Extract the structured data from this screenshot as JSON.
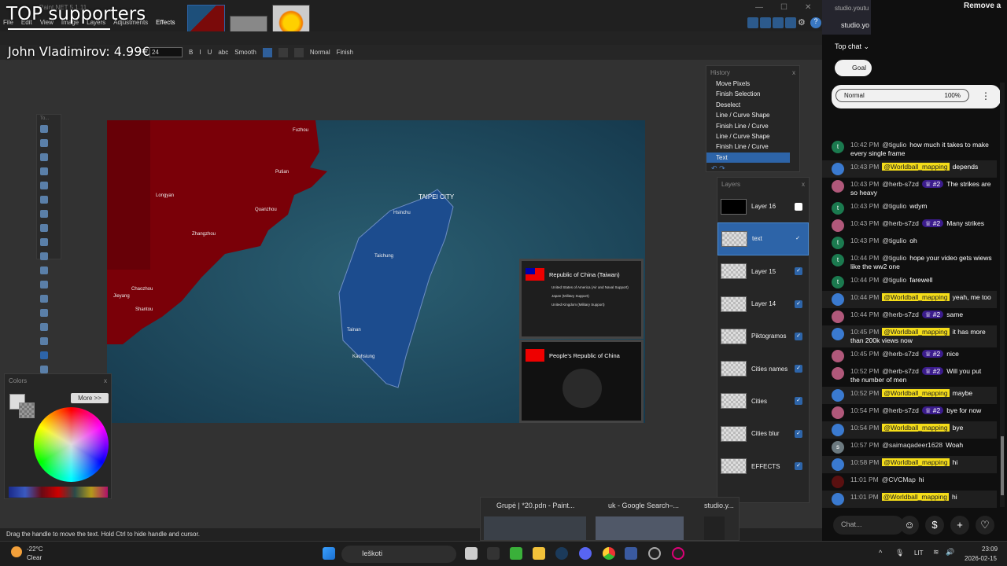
{
  "overlay": {
    "title": "TOP supporters",
    "donor": "John Vladimirov: 4.99€"
  },
  "app": {
    "title": "Paint.NET 5.1.11",
    "menu": [
      "File",
      "Edit",
      "View",
      "Image",
      "Layers",
      "Adjustments",
      "Effects"
    ]
  },
  "toolbar": {
    "font_size": "24",
    "antialias": "Smooth",
    "blend": "Normal",
    "finish": "Finish",
    "bold": "B",
    "italic": "I",
    "underline": "U",
    "strike": "abc"
  },
  "history": {
    "title": "History",
    "close": "x",
    "items": [
      "Move Pixels",
      "Finish Selection",
      "Deselect",
      "Line / Curve Shape",
      "Finish Line / Curve",
      "Line / Curve Shape",
      "Finish Line / Curve",
      "Text"
    ],
    "selected": 7
  },
  "layers": {
    "title": "Layers",
    "close": "x",
    "items": [
      {
        "name": "Layer 16",
        "visible": false
      },
      {
        "name": "text",
        "visible": true,
        "selected": true
      },
      {
        "name": "Layer 15",
        "visible": true
      },
      {
        "name": "Layer 14",
        "visible": true
      },
      {
        "name": "Piktogramos",
        "visible": true
      },
      {
        "name": "Cities names",
        "visible": true
      },
      {
        "name": "Cities",
        "visible": true
      },
      {
        "name": "Cities blur",
        "visible": true
      },
      {
        "name": "EFFECTS",
        "visible": true
      }
    ]
  },
  "colors": {
    "title": "Colors",
    "close": "x",
    "more": "More >>"
  },
  "tools": {
    "title": "To..."
  },
  "map": {
    "cities": [
      "Fuzhou",
      "Putian",
      "Longyan",
      "Quanzhou",
      "Zhangzhou",
      "Chaozhou",
      "Jieyang",
      "Shantou",
      "TAIPEI CITY",
      "Hsinchu",
      "Taichung",
      "Tainan",
      "Kaohsiung"
    ],
    "card_roc": {
      "title": "Republic of China (Taiwan)",
      "allies": [
        "United States of America (Air and Naval Support)",
        "Japan (Military Support)",
        "United Kingdom (Military Support)"
      ]
    },
    "card_prc": {
      "title": "People's Republic of China"
    }
  },
  "status": {
    "hint": "Drag the handle to move the text. Hold Ctrl to hide handle and cursor."
  },
  "taskbar": {
    "weather_temp": "-22°C",
    "weather_desc": "Clear",
    "search": "Ieškoti",
    "lang": "LIT",
    "time": "23:09",
    "date": "2026-02-15",
    "preview": [
      "Grupė | *20.pdn - Paint...",
      "uk - Google Search–...",
      "studio.y..."
    ]
  },
  "chat": {
    "tabs": [
      "studio.youtu",
      "studio.yo"
    ],
    "header": "Remove a",
    "mode": "Top chat",
    "goal": "Goal",
    "pill_label": "Normal",
    "pill_value": "100%",
    "input_placeholder": "Chat...",
    "colors": {
      "owner": "#f5dd19",
      "badge": "#3b1c8c"
    },
    "messages": [
      {
        "time": "10:42 PM",
        "author": "@tigulio",
        "av": "t",
        "avc": "#1b7a4f",
        "text": "how much it takes to make every single frame"
      },
      {
        "time": "10:43 PM",
        "author": "@Worldball_mapping",
        "owner": true,
        "text": "depends"
      },
      {
        "time": "10:43 PM",
        "author": "@herb-s7zd",
        "badge": "♕ #2",
        "text": "The strikes are so heavy"
      },
      {
        "time": "10:43 PM",
        "author": "@tigulio",
        "av": "t",
        "avc": "#1b7a4f",
        "text": "wdym"
      },
      {
        "time": "10:43 PM",
        "author": "@herb-s7zd",
        "badge": "♕ #2",
        "text": "Many strikes"
      },
      {
        "time": "10:43 PM",
        "author": "@tigulio",
        "av": "t",
        "avc": "#1b7a4f",
        "text": "oh"
      },
      {
        "time": "10:44 PM",
        "author": "@tigulio",
        "av": "t",
        "avc": "#1b7a4f",
        "text": "hope your video gets wiews like the ww2 one"
      },
      {
        "time": "10:44 PM",
        "author": "@tigulio",
        "av": "t",
        "avc": "#1b7a4f",
        "text": "farewell"
      },
      {
        "time": "10:44 PM",
        "author": "@Worldball_mapping",
        "owner": true,
        "text": "yeah, me too"
      },
      {
        "time": "10:44 PM",
        "author": "@herb-s7zd",
        "badge": "♕ #2",
        "text": "same"
      },
      {
        "time": "10:45 PM",
        "author": "@Worldball_mapping",
        "owner": true,
        "text": "it has more than 200k views now"
      },
      {
        "time": "10:45 PM",
        "author": "@herb-s7zd",
        "badge": "♕ #2",
        "text": "nice"
      },
      {
        "time": "10:52 PM",
        "author": "@herb-s7zd",
        "badge": "♕ #2",
        "text": "Will you put the number of men"
      },
      {
        "time": "10:52 PM",
        "author": "@Worldball_mapping",
        "owner": true,
        "text": "maybe"
      },
      {
        "time": "10:54 PM",
        "author": "@herb-s7zd",
        "badge": "♕ #2",
        "text": "bye for now"
      },
      {
        "time": "10:54 PM",
        "author": "@Worldball_mapping",
        "owner": true,
        "text": "bye"
      },
      {
        "time": "10:57 PM",
        "author": "@saimaqadeer1628",
        "av": "s",
        "avc": "#6c7a80",
        "text": "Woah"
      },
      {
        "time": "10:58 PM",
        "author": "@Worldball_mapping",
        "owner": true,
        "text": "hi"
      },
      {
        "time": "11:01 PM",
        "author": "@CVCMap",
        "avc": "#5a1010",
        "text": "hi"
      },
      {
        "time": "11:01 PM",
        "author": "@Worldball_mapping",
        "owner": true,
        "text": "hi"
      }
    ]
  }
}
